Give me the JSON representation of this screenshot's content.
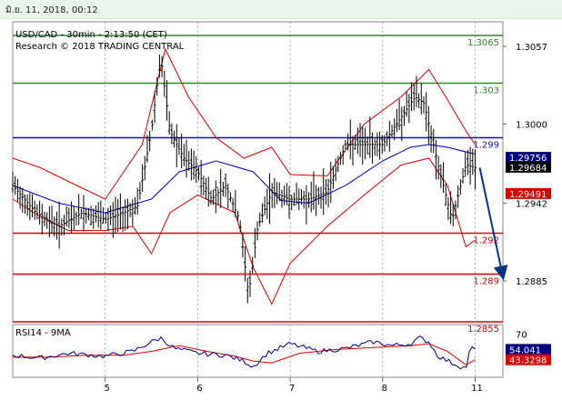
{
  "top_bar": {
    "date_text": "มิ.ย. 11, 2018, 00:12"
  },
  "header": {
    "line1": "USD/CAD - 30min - 2:13:50 (CET)",
    "line2": "Research © 2018 TRADING CENTRAL"
  },
  "colors": {
    "price": "#000000",
    "moving_average": "#0000c8",
    "bollinger": "#dd0000",
    "resistance": "#2a8a2a",
    "pivot": "#1010c0",
    "support": "#dd0000",
    "arrow": "#0a2f8a",
    "rsi": "#000080",
    "rsi_ma": "#dd0000",
    "grid": "#8a8a8a",
    "tag_current": "#000000",
    "tag_pivot": "#000080",
    "tag_support": "#dd0000"
  },
  "chart_data": [
    {
      "type": "candlestick",
      "title": "USD/CAD - 30min",
      "ylim": [
        1.2855,
        1.3075
      ],
      "y_ticks": [
        "1.3057",
        "1.3000",
        "1.2942",
        "1.2885"
      ],
      "y_tick_values": [
        1.3057,
        1.3,
        1.2942,
        1.2885
      ],
      "x_ticks": [
        "5",
        "6",
        "7",
        "8",
        "11"
      ],
      "levels": [
        {
          "label": "1.3065",
          "value": 1.3065,
          "kind": "resistance"
        },
        {
          "label": "1.303",
          "value": 1.303,
          "kind": "resistance"
        },
        {
          "label": "1.299",
          "value": 1.299,
          "kind": "pivot"
        },
        {
          "label": "1.292",
          "value": 1.292,
          "kind": "support"
        },
        {
          "label": "1.289",
          "value": 1.289,
          "kind": "support"
        },
        {
          "label": "1.2855",
          "value": 1.2855,
          "kind": "support"
        }
      ],
      "price_tags": [
        {
          "label": "1.29756",
          "value": 1.29756,
          "kind": "pivot"
        },
        {
          "label": "1.29684",
          "value": 1.29684,
          "kind": "current"
        },
        {
          "label": "1.29491",
          "value": 1.29491,
          "kind": "support"
        }
      ],
      "projection": {
        "from": 1.2968,
        "to": 1.2888
      },
      "series": [
        {
          "name": "price",
          "x": [
            4.0,
            4.25,
            4.5,
            4.75,
            5.0,
            5.2,
            5.35,
            5.5,
            5.6,
            5.7,
            5.85,
            6.0,
            6.15,
            6.3,
            6.45,
            6.55,
            6.65,
            6.8,
            7.0,
            7.2,
            7.4,
            7.6,
            7.8,
            8.0,
            8.2,
            8.35,
            8.45,
            8.6,
            8.75,
            8.9,
            9.0
          ],
          "values": [
            1.2955,
            1.2935,
            1.2925,
            1.2935,
            1.293,
            1.2935,
            1.294,
            1.2995,
            1.305,
            1.2995,
            1.2975,
            1.2965,
            1.2945,
            1.2955,
            1.293,
            1.2875,
            1.2925,
            1.295,
            1.2945,
            1.2945,
            1.295,
            1.2985,
            1.2985,
            1.2985,
            1.3005,
            1.302,
            1.3015,
            1.297,
            1.293,
            1.297,
            1.2968
          ]
        },
        {
          "name": "moving_average",
          "x": [
            4.0,
            4.5,
            5.0,
            5.5,
            5.8,
            6.2,
            6.6,
            6.9,
            7.2,
            7.6,
            8.0,
            8.3,
            8.5,
            8.7,
            9.0
          ],
          "values": [
            1.2955,
            1.2942,
            1.2935,
            1.2945,
            1.2965,
            1.2973,
            1.2965,
            1.2944,
            1.2942,
            1.2955,
            1.2973,
            1.2983,
            1.2985,
            1.2983,
            1.2978
          ]
        },
        {
          "name": "bollinger_upper",
          "x": [
            4.0,
            4.3,
            4.6,
            5.0,
            5.4,
            5.65,
            5.9,
            6.2,
            6.5,
            6.8,
            7.0,
            7.4,
            7.8,
            8.2,
            8.5,
            8.7,
            8.9,
            9.0
          ],
          "values": [
            1.2975,
            1.2968,
            1.2958,
            1.2945,
            1.2985,
            1.3055,
            1.302,
            1.299,
            1.2975,
            1.2983,
            1.2963,
            1.2962,
            1.3,
            1.302,
            1.304,
            1.3018,
            1.2995,
            1.2985
          ]
        },
        {
          "name": "bollinger_lower",
          "x": [
            4.0,
            4.3,
            4.6,
            5.0,
            5.3,
            5.5,
            5.7,
            6.0,
            6.4,
            6.6,
            6.8,
            7.0,
            7.4,
            7.8,
            8.2,
            8.5,
            8.7,
            8.9,
            9.0
          ],
          "values": [
            1.2945,
            1.2932,
            1.2922,
            1.2922,
            1.2925,
            1.2905,
            1.2935,
            1.2948,
            1.2935,
            1.2895,
            1.2868,
            1.2898,
            1.2925,
            1.2948,
            1.297,
            1.2975,
            1.2955,
            1.291,
            1.2915
          ]
        }
      ]
    },
    {
      "type": "line",
      "title": "RSI14 - 9MA",
      "ylim": [
        25,
        80
      ],
      "y_ticks": [
        "70"
      ],
      "y_tick_values": [
        70
      ],
      "values_tags": [
        {
          "label": "54.041",
          "value": 54.041,
          "kind": "pivot"
        },
        {
          "label": "43.3298",
          "value": 43.3298,
          "kind": "support"
        }
      ],
      "series": [
        {
          "name": "RSI14",
          "x": [
            4.0,
            4.3,
            4.6,
            5.0,
            5.3,
            5.5,
            5.6,
            5.75,
            6.0,
            6.3,
            6.5,
            6.6,
            6.75,
            7.0,
            7.3,
            7.6,
            7.9,
            8.1,
            8.3,
            8.4,
            8.5,
            8.6,
            8.75,
            8.9,
            8.95,
            9.0
          ],
          "values": [
            48,
            45,
            50,
            47,
            52,
            62,
            66,
            55,
            50,
            48,
            42,
            36,
            50,
            60,
            52,
            55,
            62,
            58,
            60,
            66,
            62,
            47,
            40,
            34,
            56,
            54.041
          ]
        },
        {
          "name": "9MA",
          "x": [
            4.0,
            4.4,
            4.8,
            5.2,
            5.5,
            5.8,
            6.1,
            6.4,
            6.6,
            6.8,
            7.1,
            7.5,
            7.9,
            8.3,
            8.5,
            8.7,
            8.9,
            9.0
          ],
          "values": [
            46,
            46,
            48,
            48,
            52,
            58,
            52,
            47,
            42,
            40,
            50,
            54,
            56,
            58,
            60,
            52,
            38,
            43.3298
          ]
        }
      ]
    }
  ]
}
